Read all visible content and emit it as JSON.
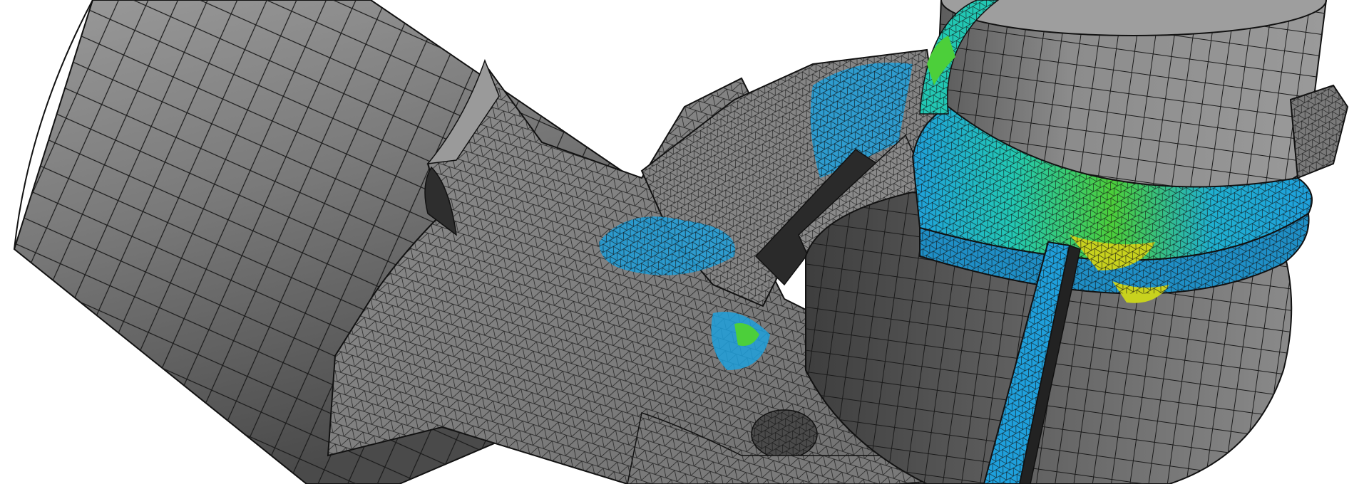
{
  "scene": {
    "subject": "fea-mesh-assembly",
    "background_color": "#ffffff",
    "mesh_base_color": "#8a8a8a",
    "mesh_line_color": "#1a1a1a",
    "stress_colors": [
      "#1fa0dc",
      "#22c8b4",
      "#4ccf3a",
      "#c8d21e"
    ]
  }
}
